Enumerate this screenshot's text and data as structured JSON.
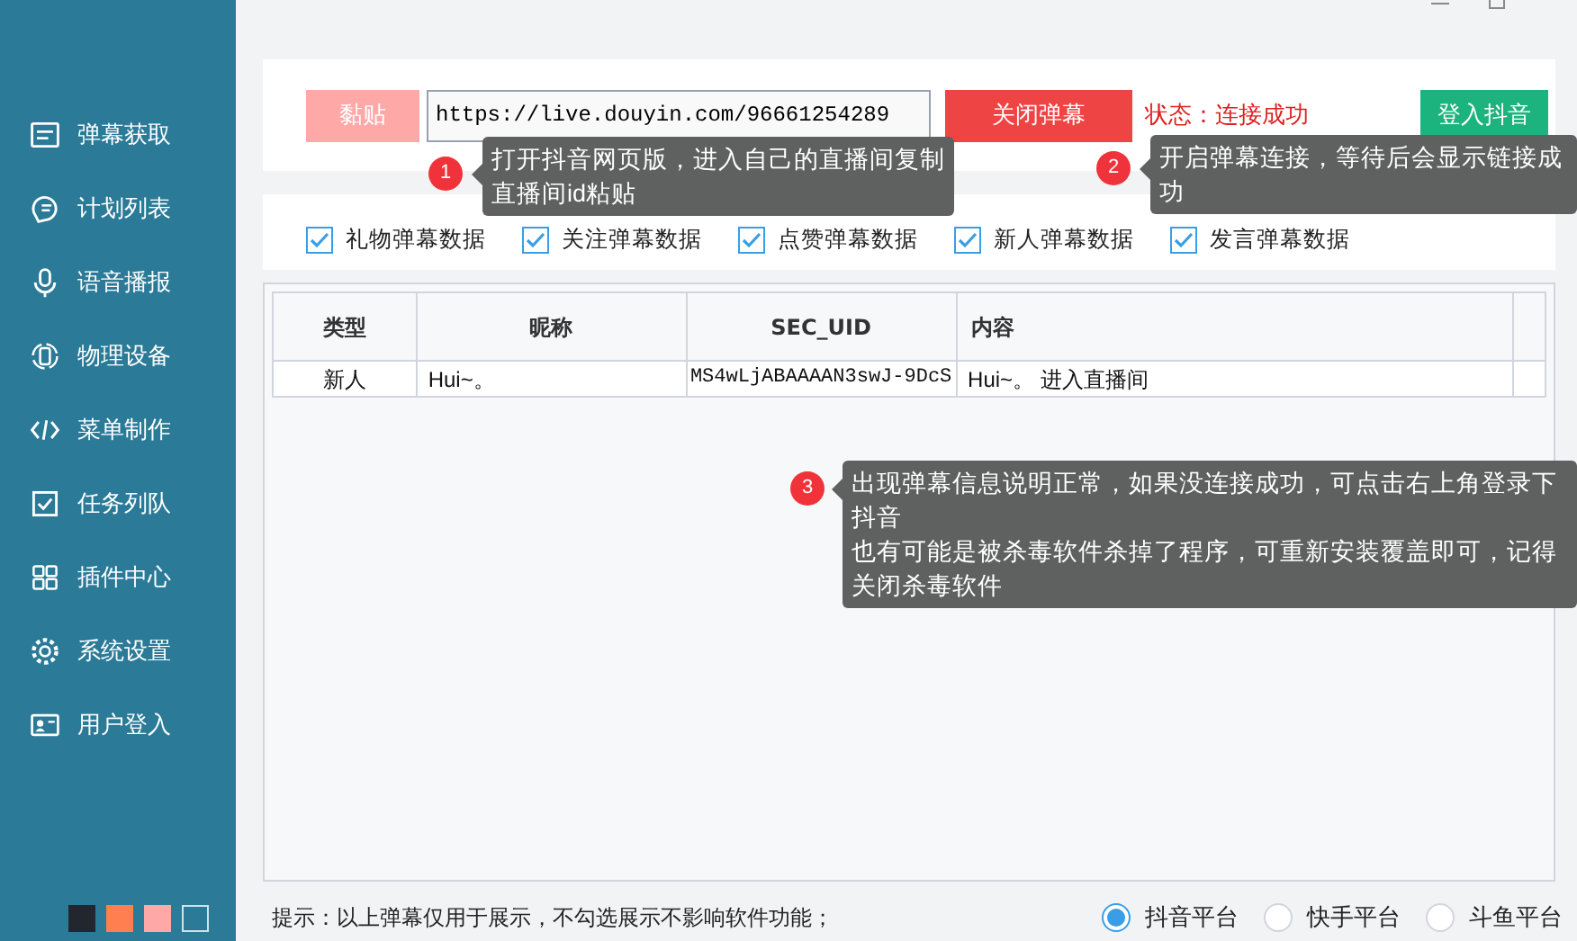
{
  "sidebar": {
    "items": [
      {
        "label": "弹幕获取"
      },
      {
        "label": "计划列表"
      },
      {
        "label": "语音播报"
      },
      {
        "label": "物理设备"
      },
      {
        "label": "菜单制作"
      },
      {
        "label": "任务列队"
      },
      {
        "label": "插件中心"
      },
      {
        "label": "系统设置"
      },
      {
        "label": "用户登入"
      }
    ],
    "themes": [
      {
        "color": "#22262e",
        "selected": false
      },
      {
        "color": "#ff7f50",
        "selected": false
      },
      {
        "color": "#ffa8a8",
        "selected": false
      },
      {
        "color": "#2b7a97",
        "selected": true
      }
    ]
  },
  "toolbar": {
    "paste_button": "黏贴",
    "url": "https://live.douyin.com/96661254289",
    "close_button": "关闭弹幕",
    "status": "状态：连接成功",
    "login_button": "登入抖音"
  },
  "filters": [
    {
      "label": "礼物弹幕数据",
      "checked": true
    },
    {
      "label": "关注弹幕数据",
      "checked": true
    },
    {
      "label": "点赞弹幕数据",
      "checked": true
    },
    {
      "label": "新人弹幕数据",
      "checked": true
    },
    {
      "label": "发言弹幕数据",
      "checked": true
    }
  ],
  "table": {
    "columns": [
      "类型",
      "昵称",
      "SEC_UID",
      "内容"
    ],
    "rows": [
      [
        "新人",
        "Hui~。",
        "MS4wLjABAAAAN3swJ-9DcS",
        "Hui~。 进入直播间"
      ]
    ]
  },
  "tips": [
    {
      "number": "1",
      "lines": [
        "打开抖音网页版，进入自己的直播间复制直播间id粘贴"
      ]
    },
    {
      "number": "2",
      "lines": [
        "开启弹幕连接，等待后会显示链接成功"
      ]
    },
    {
      "number": "3",
      "lines": [
        "出现弹幕信息说明正常，如果没连接成功，可点击右上角登录下抖音",
        "也有可能是被杀毒软件杀掉了程序，可重新安装覆盖即可，记得关闭杀毒软件"
      ]
    }
  ],
  "footer": {
    "hint": "提示：以上弹幕仅用于展示，不勾选展示不影响软件功能；",
    "platforms": [
      {
        "label": "抖音平台",
        "selected": true
      },
      {
        "label": "快手平台",
        "selected": false
      },
      {
        "label": "斗鱼平台",
        "selected": false
      }
    ]
  }
}
